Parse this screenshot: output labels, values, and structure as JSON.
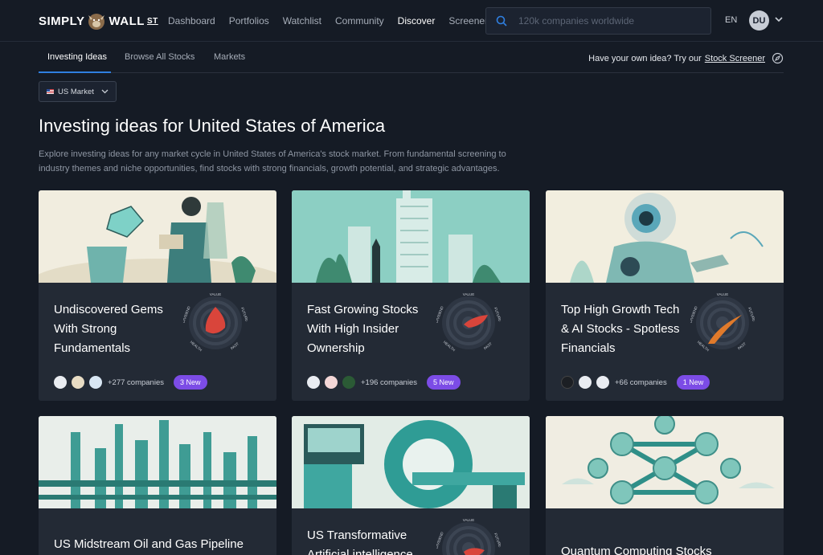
{
  "brand": {
    "left": "SIMPLY",
    "right": "WALL",
    "suffix": "ST"
  },
  "nav": {
    "items": [
      "Dashboard",
      "Portfolios",
      "Watchlist",
      "Community",
      "Discover",
      "Screener"
    ],
    "active": "Discover"
  },
  "search": {
    "placeholder": "120k companies worldwide"
  },
  "lang": "EN",
  "user": {
    "initials": "DU"
  },
  "subnav": {
    "tabs": [
      "Investing Ideas",
      "Browse All Stocks",
      "Markets"
    ],
    "active": "Investing Ideas",
    "idea_prefix": "Have your own idea? Try our",
    "idea_link": "Stock Screener"
  },
  "market": {
    "selected": "US Market"
  },
  "page": {
    "title": "Investing ideas for United States of America",
    "intro": "Explore investing ideas for any market cycle in United States of America's stock market. From fundamental screening to industry themes and niche opportunities, find stocks with strong financials, growth potential, and strategic advantages."
  },
  "snowflake_labels": {
    "value": "VALUE",
    "future": "FUTURE",
    "past": "PAST",
    "health": "HEALTH",
    "dividend": "DIVIDEND"
  },
  "cards": [
    {
      "title": "Undiscovered Gems With Strong Fundamentals",
      "companies": "+277 companies",
      "badge": "3 New",
      "shape_color": "#d9453b"
    },
    {
      "title": "Fast Growing Stocks With High Insider Ownership",
      "companies": "+196 companies",
      "badge": "5 New",
      "shape_color": "#d9453b"
    },
    {
      "title": "Top High Growth Tech & AI Stocks - Spotless Financials",
      "companies": "+66 companies",
      "badge": "1 New",
      "shape_color": "#e07a2b"
    },
    {
      "title": "US Midstream Oil and Gas Pipeline",
      "companies": "",
      "badge": ""
    },
    {
      "title": "US Transformative Artificial intelligence",
      "companies": "",
      "badge": "",
      "shape_color": "#d9453b"
    },
    {
      "title": "Quantum Computing Stocks",
      "companies": "",
      "badge": ""
    }
  ],
  "colors": {
    "accent": "#2f7fe0",
    "badge": "#7c4ce6",
    "background": "#151b25",
    "card": "#232a35"
  }
}
